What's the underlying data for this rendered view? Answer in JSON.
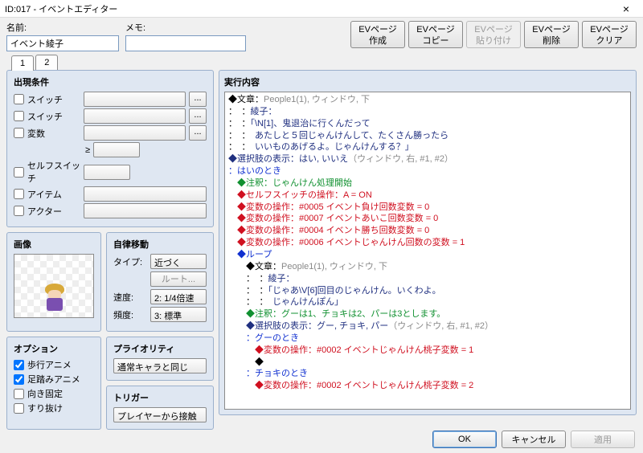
{
  "window": {
    "title": "ID:017 - イベントエディター"
  },
  "top": {
    "name_label": "名前:",
    "name_value": "イベント綾子",
    "memo_label": "メモ:",
    "memo_value": ""
  },
  "ev_buttons": {
    "create": "EVページ\n作成",
    "copy": "EVページ\nコピー",
    "paste": "EVページ\n貼り付け",
    "delete": "EVページ\n削除",
    "clear": "EVページ\nクリア"
  },
  "tabs": [
    "1",
    "2"
  ],
  "cond": {
    "header": "出現条件",
    "switch": "スイッチ",
    "variable": "変数",
    "gte": "≥",
    "self_switch": "セルフスイッチ",
    "item": "アイテム",
    "actor": "アクター"
  },
  "image": {
    "header": "画像"
  },
  "autonomous": {
    "header": "自律移動",
    "type_label": "タイプ:",
    "type_value": "近づく",
    "route_btn": "ルート...",
    "speed_label": "速度:",
    "speed_value": "2: 1/4倍速",
    "freq_label": "頻度:",
    "freq_value": "3: 標準"
  },
  "options": {
    "header": "オプション",
    "walk_anim": "歩行アニメ",
    "step_anim": "足踏みアニメ",
    "dir_fix": "向き固定",
    "through": "すり抜け"
  },
  "priority": {
    "header": "プライオリティ",
    "value": "通常キャラと同じ"
  },
  "trigger": {
    "header": "トリガー",
    "value": "プレイヤーから接触"
  },
  "exec": {
    "header": "実行内容",
    "lines": [
      {
        "c": "c-black",
        "t": "◆文章：",
        "tail": "People1(1), ウィンドウ, 下",
        "tc": "c-gray"
      },
      {
        "c": "c-black",
        "t": "：　：",
        "tail": "綾子：",
        "tc": "c-navy"
      },
      {
        "c": "c-black",
        "t": "：　：",
        "tail": "「\\N[1]、鬼退治に行くんだって",
        "tc": "c-navy"
      },
      {
        "c": "c-black",
        "t": "：　：",
        "tail": "　あたしと５回じゃんけんして、たくさん勝ったら",
        "tc": "c-navy"
      },
      {
        "c": "c-black",
        "t": "：　：",
        "tail": "　いいものあげるよ。じゃんけんする？」",
        "tc": "c-navy"
      },
      {
        "c": "c-navy",
        "t": "◆選択肢の表示：はい, いいえ",
        "tail": "（ウィンドウ, 右, #1, #2）",
        "tc": "c-gray"
      },
      {
        "c": "c-blue",
        "t": "：はいのとき"
      },
      {
        "c": "c-green",
        "t": "　◆注釈：じゃんけん処理開始"
      },
      {
        "c": "c-red",
        "t": "　◆セルフスイッチの操作：A = ON"
      },
      {
        "c": "c-red",
        "t": "　◆変数の操作：#0005 イベント負け回数変数 = 0"
      },
      {
        "c": "c-red",
        "t": "　◆変数の操作：#0007 イベントあいこ回数変数 = 0"
      },
      {
        "c": "c-red",
        "t": "　◆変数の操作：#0004 イベント勝ち回数変数 = 0"
      },
      {
        "c": "c-red",
        "t": "　◆変数の操作：#0006 イベントじゃんけん回数の変数 = 1"
      },
      {
        "c": "c-blue",
        "t": "　◆ループ"
      },
      {
        "c": "c-black",
        "t": "　　◆文章：",
        "tail": "People1(1), ウィンドウ, 下",
        "tc": "c-gray"
      },
      {
        "c": "c-black",
        "t": "　　：　：",
        "tail": "綾子：",
        "tc": "c-navy"
      },
      {
        "c": "c-black",
        "t": "　　：　：",
        "tail": "「じゃあ\\V[6]回目のじゃんけん。いくわよ。",
        "tc": "c-navy"
      },
      {
        "c": "c-black",
        "t": "　　：　：",
        "tail": "　じゃんけんぽん」",
        "tc": "c-navy"
      },
      {
        "c": "c-green",
        "t": "　　◆注釈：グーは1、チョキは2、パーは3とします。"
      },
      {
        "c": "c-navy",
        "t": "　　◆選択肢の表示：グー, チョキ, パー",
        "tail": "（ウィンドウ, 右, #1, #2）",
        "tc": "c-gray"
      },
      {
        "c": "c-blue",
        "t": "　　：グーのとき"
      },
      {
        "c": "c-red",
        "t": "　　　◆変数の操作：#0002 イベントじゃんけん桃子変数 = 1"
      },
      {
        "c": "c-black",
        "t": "　　　◆"
      },
      {
        "c": "c-blue",
        "t": "　　：チョキのとき"
      },
      {
        "c": "c-red",
        "t": "　　　◆変数の操作：#0002 イベントじゃんけん桃子変数 = 2"
      }
    ]
  },
  "footer": {
    "ok": "OK",
    "cancel": "キャンセル",
    "apply": "適用"
  }
}
